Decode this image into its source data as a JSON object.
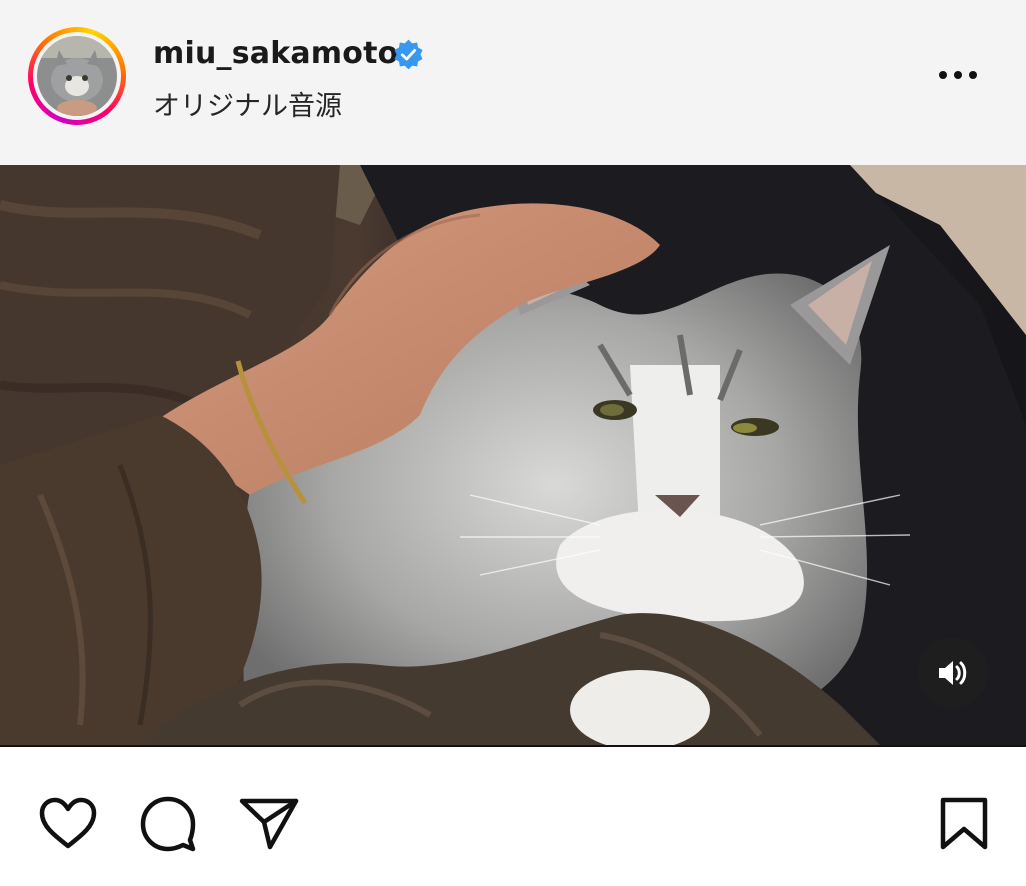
{
  "post": {
    "username": "miu_sakamoto",
    "verified": true,
    "audio_label": "オリジナル音源"
  },
  "icons": {
    "avatar": "avatar",
    "verified": "verified-badge-icon",
    "more": "more-options-icon",
    "mute": "volume-icon",
    "like": "heart-icon",
    "comment": "comment-bubble-icon",
    "share": "paper-plane-icon",
    "save": "bookmark-icon"
  },
  "colors": {
    "header_bg": "#f4f4f4",
    "verified_blue": "#3897f0",
    "icon": "#111111"
  }
}
